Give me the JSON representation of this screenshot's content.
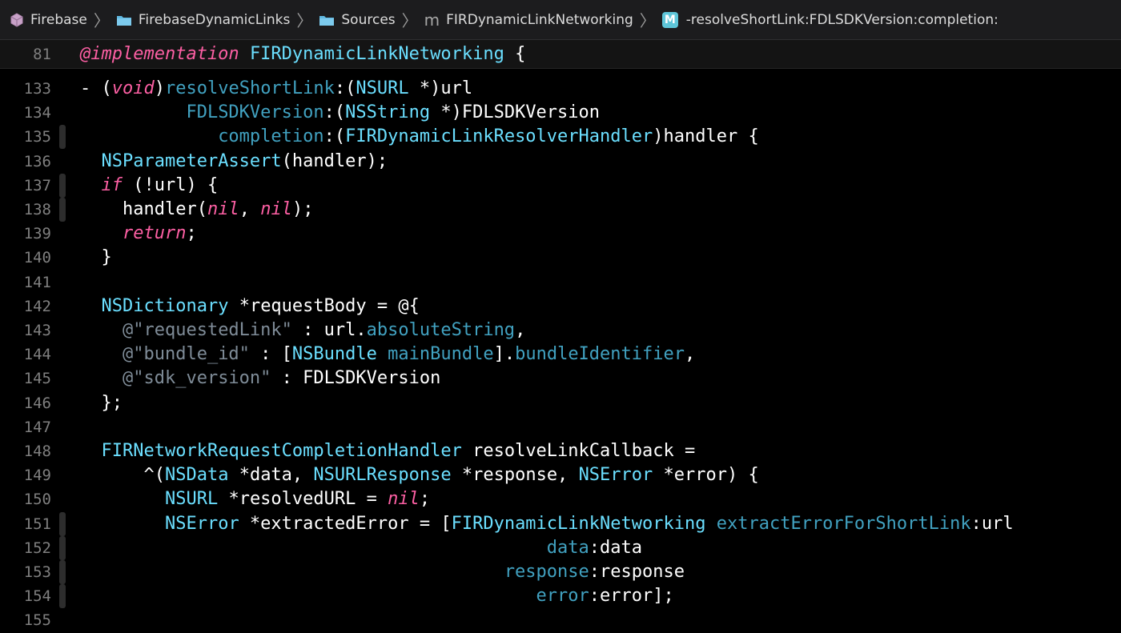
{
  "jumpbar": {
    "items": [
      {
        "label": "Firebase",
        "icon": "package-icon"
      },
      {
        "label": "FirebaseDynamicLinks",
        "icon": "folder-icon"
      },
      {
        "label": "Sources",
        "icon": "folder-icon"
      },
      {
        "label": "FIRDynamicLinkNetworking",
        "icon": "m-letter-icon",
        "icon_text": "m"
      },
      {
        "label": "-resolveShortLink:FDLSDKVersion:completion:",
        "icon": "method-badge-icon",
        "icon_text": "M"
      }
    ]
  },
  "sticky_header": {
    "line_number": "81",
    "keyword": "@implementation",
    "class_name": "FIRDynamicLinkNetworking",
    "brace": " {"
  },
  "code": {
    "lines": [
      {
        "num": "133",
        "tokens": [
          [
            "- (",
            ""
          ],
          [
            "void",
            "k"
          ],
          [
            ")",
            ""
          ],
          [
            "resolveShortLink",
            "c"
          ],
          [
            ":(",
            ""
          ],
          [
            "NSURL",
            "t"
          ],
          [
            " *)url",
            ""
          ]
        ]
      },
      {
        "num": "134",
        "tokens": [
          [
            "          ",
            ""
          ],
          [
            "FDLSDKVersion",
            "c"
          ],
          [
            ":(",
            ""
          ],
          [
            "NSString",
            "t"
          ],
          [
            " *)FDLSDKVersion",
            ""
          ]
        ]
      },
      {
        "num": "135",
        "tokens": [
          [
            "             ",
            ""
          ],
          [
            "completion",
            "c"
          ],
          [
            ":(",
            ""
          ],
          [
            "FIRDynamicLinkResolverHandler",
            "t"
          ],
          [
            ")handler {",
            ""
          ]
        ]
      },
      {
        "num": "136",
        "tokens": [
          [
            "  ",
            ""
          ],
          [
            "NSParameterAssert",
            "t"
          ],
          [
            "(handler);",
            ""
          ]
        ]
      },
      {
        "num": "137",
        "tokens": [
          [
            "  ",
            ""
          ],
          [
            "if",
            "k"
          ],
          [
            " (!url) {",
            ""
          ]
        ]
      },
      {
        "num": "138",
        "tokens": [
          [
            "    handler(",
            ""
          ],
          [
            "nil",
            "k"
          ],
          [
            ", ",
            ""
          ],
          [
            "nil",
            "k"
          ],
          [
            ");",
            ""
          ]
        ]
      },
      {
        "num": "139",
        "tokens": [
          [
            "    ",
            ""
          ],
          [
            "return",
            "k"
          ],
          [
            ";",
            ""
          ]
        ]
      },
      {
        "num": "140",
        "tokens": [
          [
            "  }",
            ""
          ]
        ]
      },
      {
        "num": "141",
        "tokens": []
      },
      {
        "num": "142",
        "tokens": [
          [
            "  ",
            ""
          ],
          [
            "NSDictionary",
            "t"
          ],
          [
            " *requestBody = @{",
            ""
          ]
        ]
      },
      {
        "num": "143",
        "tokens": [
          [
            "    ",
            ""
          ],
          [
            "@\"requestedLink\"",
            "cm"
          ],
          [
            " : url.",
            ""
          ],
          [
            "absoluteString",
            "c"
          ],
          [
            ",",
            ""
          ]
        ]
      },
      {
        "num": "144",
        "tokens": [
          [
            "    ",
            ""
          ],
          [
            "@\"bundle_id\"",
            "cm"
          ],
          [
            " : [",
            ""
          ],
          [
            "NSBundle",
            "t"
          ],
          [
            " ",
            ""
          ],
          [
            "mainBundle",
            "c"
          ],
          [
            "].",
            ""
          ],
          [
            "bundleIdentifier",
            "c"
          ],
          [
            ",",
            ""
          ]
        ]
      },
      {
        "num": "145",
        "tokens": [
          [
            "    ",
            ""
          ],
          [
            "@\"sdk_version\"",
            "cm"
          ],
          [
            " : FDLSDKVersion",
            ""
          ]
        ]
      },
      {
        "num": "146",
        "tokens": [
          [
            "  };",
            ""
          ]
        ]
      },
      {
        "num": "147",
        "tokens": []
      },
      {
        "num": "148",
        "tokens": [
          [
            "  ",
            ""
          ],
          [
            "FIRNetworkRequestCompletionHandler",
            "t"
          ],
          [
            " resolveLinkCallback =",
            ""
          ]
        ]
      },
      {
        "num": "149",
        "tokens": [
          [
            "      ^(",
            ""
          ],
          [
            "NSData",
            "t"
          ],
          [
            " *data, ",
            ""
          ],
          [
            "NSURLResponse",
            "t"
          ],
          [
            " *response, ",
            ""
          ],
          [
            "NSError",
            "t"
          ],
          [
            " *error) {",
            ""
          ]
        ]
      },
      {
        "num": "150",
        "tokens": [
          [
            "        ",
            ""
          ],
          [
            "NSURL",
            "t"
          ],
          [
            " *resolvedURL = ",
            ""
          ],
          [
            "nil",
            "k"
          ],
          [
            ";",
            ""
          ]
        ]
      },
      {
        "num": "151",
        "tokens": [
          [
            "        ",
            ""
          ],
          [
            "NSError",
            "t"
          ],
          [
            " *extractedError = [",
            ""
          ],
          [
            "FIRDynamicLinkNetworking",
            "t"
          ],
          [
            " ",
            ""
          ],
          [
            "extractErrorForShortLink",
            "c"
          ],
          [
            ":url",
            ""
          ]
        ]
      },
      {
        "num": "152",
        "tokens": [
          [
            "                                            ",
            ""
          ],
          [
            "data",
            "c"
          ],
          [
            ":data",
            ""
          ]
        ]
      },
      {
        "num": "153",
        "tokens": [
          [
            "                                        ",
            ""
          ],
          [
            "response",
            "c"
          ],
          [
            ":response",
            ""
          ]
        ]
      },
      {
        "num": "154",
        "tokens": [
          [
            "                                           ",
            ""
          ],
          [
            "error",
            "c"
          ],
          [
            ":error];",
            ""
          ]
        ]
      },
      {
        "num": "155",
        "tokens": []
      }
    ]
  },
  "colors": {
    "keyword": "#fc5fa3",
    "type": "#6bdfff",
    "method": "#41a1c0",
    "string": "#fc6a5d",
    "line_number": "#7f7f7f",
    "background": "#000000"
  }
}
